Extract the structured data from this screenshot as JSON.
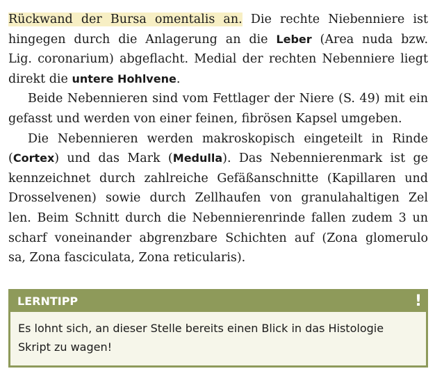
{
  "paragraph1": {
    "l1_hl": "Rückwand der Bursa omentalis an.",
    "l1_rest": " Die rechte Niebenniere ist",
    "l2_a": "hingegen durch die Anlagerung an die ",
    "l2_bold": "Leber",
    "l2_b": " (Area nuda bzw.",
    "l3": "Lig. coronarium) abgeflacht. Medial der rechten Nebenniere liegt",
    "l4_a": "direkt die ",
    "l4_bold": "untere Hohlvene",
    "l4_b": "."
  },
  "paragraph2": {
    "l1": "Beide Nebennieren sind vom Fettlager der Niere (S. 49) mit ein",
    "l2": "gefasst und werden von einer feinen, fibrösen Kapsel umgeben."
  },
  "paragraph3": {
    "l1": "Die Nebennieren werden makroskopisch eingeteilt in Rinde",
    "l2_a": "(",
    "l2_bold1": "Cortex",
    "l2_b": ") und das Mark (",
    "l2_bold2": "Medulla",
    "l2_c": "). Das Nebennierenmark ist ge",
    "l3": "kennzeichnet durch zahlreiche Gefäßanschnitte (Kapillaren und",
    "l4": "Drosselvenen) sowie durch Zellhaufen von granulahaltigen Zel",
    "l5": "len. Beim Schnitt durch die Nebennierenrinde fallen zudem 3 un",
    "l6": "scharf voneinander abgrenzbare Schichten auf (Zona glomerulo",
    "l7": "sa, Zona fasciculata, Zona reticularis)."
  },
  "lerntipp": {
    "title": "LERNTIPP",
    "mark": "!",
    "line1": "Es lohnt sich, an dieser Stelle bereits einen Blick in das Histologie",
    "line2": "Skript zu wagen!"
  },
  "colors": {
    "highlight": "#f7efc4",
    "tip_accent": "#8e9a5a",
    "tip_background": "#f6f6ea"
  }
}
